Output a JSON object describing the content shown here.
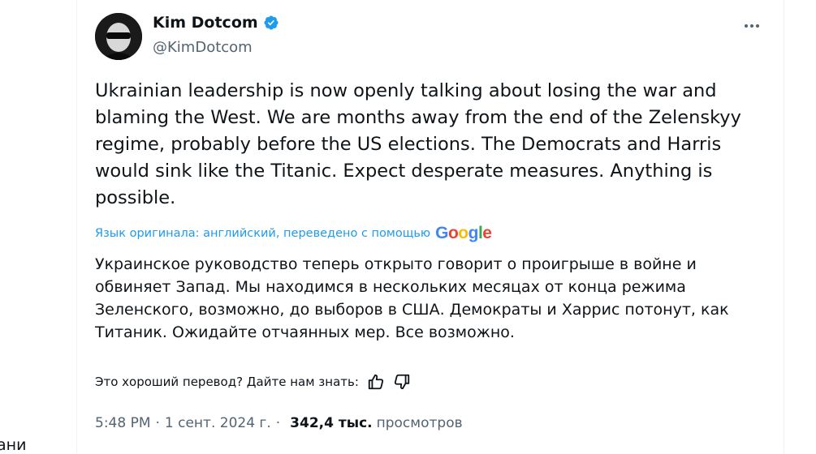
{
  "author": {
    "name": "Kim Dotcom",
    "handle": "@KimDotcom"
  },
  "tweet": {
    "text": "Ukrainian leadership is now openly talking about losing the war and blaming the West. We are months away from the end of the Zelenskyy regime, probably before the US elections. The Democrats and Harris would sink like the Titanic. Expect desperate measures. Anything is possible."
  },
  "translation": {
    "note": "Язык оригинала: английский, переведено с помощью",
    "provider": "Google",
    "text": "Украинское руководство теперь открыто говорит о проигрыше в войне и обвиняет Запад. Мы находимся в нескольких месяцах от конца режима Зеленского, возможно, до выборов в США. Демократы и Харрис потонут, как Титаник. Ожидайте отчаянных мер. Все возможно.",
    "feedback_question": "Это хороший перевод? Дайте нам знать:"
  },
  "meta": {
    "time": "5:48 PM",
    "date": "1 сент. 2024 г.",
    "views_count": "342,4 тыс.",
    "views_label": "просмотров"
  },
  "edge_fragment": "ани",
  "colors": {
    "accent": "#1d9bf0",
    "secondary_text": "#536471",
    "primary_text": "#0f1419"
  },
  "icons": [
    "verified-badge-icon",
    "more-options-icon",
    "thumbs-up-icon",
    "thumbs-down-icon",
    "google-logo"
  ]
}
